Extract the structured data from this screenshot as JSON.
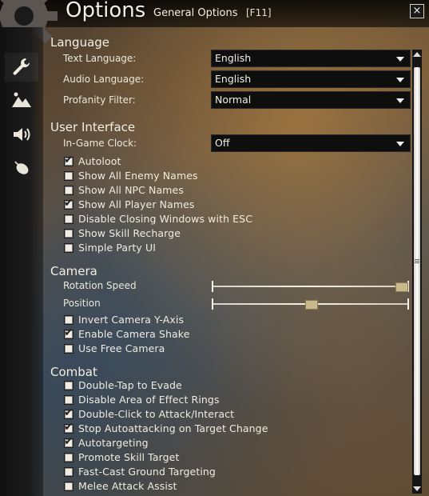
{
  "header": {
    "title": "Options",
    "subtitle": "General Options",
    "hotkey": "[F11]",
    "close_label": "×"
  },
  "sidebar": {
    "tabs": [
      {
        "icon": "wrench-icon",
        "active": true
      },
      {
        "icon": "mountain-icon",
        "active": false
      },
      {
        "icon": "speaker-icon",
        "active": false
      },
      {
        "icon": "mouse-icon",
        "active": false
      }
    ]
  },
  "language": {
    "title": "Language",
    "text_language": {
      "label": "Text Language:",
      "value": "English"
    },
    "audio_language": {
      "label": "Audio Language:",
      "value": "English"
    },
    "profanity_filter": {
      "label": "Profanity Filter:",
      "value": "Normal"
    }
  },
  "ui": {
    "title": "User Interface",
    "clock": {
      "label": "In-Game Clock:",
      "value": "Off"
    },
    "checkboxes": [
      {
        "label": "Autoloot",
        "checked": true
      },
      {
        "label": "Show All Enemy Names",
        "checked": false
      },
      {
        "label": "Show All NPC Names",
        "checked": false
      },
      {
        "label": "Show All Player Names",
        "checked": true
      },
      {
        "label": "Disable Closing Windows with ESC",
        "checked": false
      },
      {
        "label": "Show Skill Recharge",
        "checked": false
      },
      {
        "label": "Simple Party UI",
        "checked": false
      }
    ]
  },
  "camera": {
    "title": "Camera",
    "rotation_speed": {
      "label": "Rotation Speed",
      "value": 0.96
    },
    "position": {
      "label": "Position",
      "value": 0.5
    },
    "checkboxes": [
      {
        "label": "Invert Camera Y-Axis",
        "checked": false
      },
      {
        "label": "Enable Camera Shake",
        "checked": true
      },
      {
        "label": "Use Free Camera",
        "checked": false
      }
    ]
  },
  "combat": {
    "title": "Combat",
    "checkboxes": [
      {
        "label": "Double-Tap to Evade",
        "checked": false
      },
      {
        "label": "Disable Area of Effect Rings",
        "checked": false
      },
      {
        "label": "Double-Click to Attack/Interact",
        "checked": true
      },
      {
        "label": "Stop Autoattacking on Target Change",
        "checked": true
      },
      {
        "label": "Autotargeting",
        "checked": true
      },
      {
        "label": "Promote Skill Target",
        "checked": false
      },
      {
        "label": "Fast-Cast Ground Targeting",
        "checked": false
      },
      {
        "label": "Melee Attack Assist",
        "checked": false
      }
    ]
  },
  "colors": {
    "checkbox_fill": "#f1ede2",
    "dropdown_bg": "#0e0e0e",
    "slider_thumb": "#c9b98a"
  }
}
